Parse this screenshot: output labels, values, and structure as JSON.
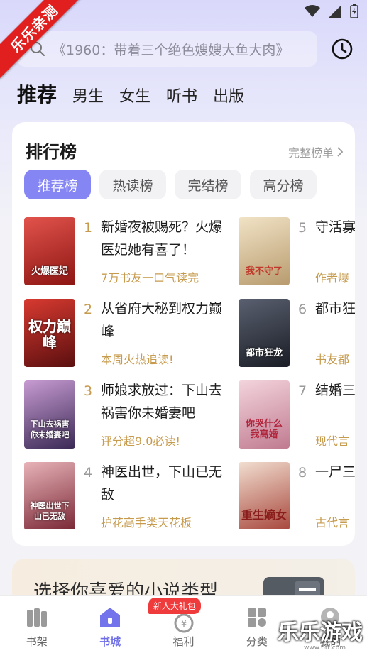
{
  "watermark": {
    "ribbon": "乐乐亲测",
    "site": "乐乐游戏",
    "url": "www.6tt.com"
  },
  "search": {
    "placeholder": "《1960：带着三个绝色嫂嫂大鱼大肉》"
  },
  "top_tabs": [
    {
      "label": "推荐",
      "active": true
    },
    {
      "label": "男生"
    },
    {
      "label": "女生"
    },
    {
      "label": "听书"
    },
    {
      "label": "出版"
    }
  ],
  "ranking": {
    "title": "排行榜",
    "more": "完整榜单",
    "tabs": [
      {
        "label": "推荐榜",
        "active": true
      },
      {
        "label": "热读榜"
      },
      {
        "label": "完结榜"
      },
      {
        "label": "高分榜"
      }
    ],
    "books": [
      {
        "rank": "1",
        "title": "新婚夜被赐死？火爆医妃她有喜了！",
        "tag": "7万书友一口气读完",
        "cover_text": "火爆医妃",
        "cover_color": "#b72420"
      },
      {
        "rank": "2",
        "title": "从省府大秘到权力巅峰",
        "tag": "本周火热追读!",
        "cover_text": "权力巅峰",
        "cover_color": "#8e1a1a"
      },
      {
        "rank": "3",
        "title": "师娘求放过：下山去祸害你未婚妻吧",
        "tag": "评分超9.0必读!",
        "cover_text": "下山去祸害你未婚妻吧",
        "cover_color": "#6b4a8a"
      },
      {
        "rank": "4",
        "title": "神医出世，下山已无敌",
        "tag": "护花高手类天花板",
        "cover_text": "神医出世下山已无敌",
        "cover_color": "#b25a66"
      },
      {
        "rank": "5",
        "title": "守活寡区离婚",
        "tag": "作者爆",
        "cover_text": "我不守了",
        "cover_color": "#cfb68f"
      },
      {
        "rank": "6",
        "title": "都市狂",
        "tag": "书友都",
        "cover_text": "都市狂龙",
        "cover_color": "#2e3440"
      },
      {
        "rank": "7",
        "title": "结婚三我离婚",
        "tag": "现代言",
        "cover_text": "你哭什么我离婚",
        "cover_color": "#d7a7b6"
      },
      {
        "rank": "8",
        "title": "一尸三生嫡女",
        "tag": "古代言",
        "cover_text": "重生嫡女",
        "cover_color": "#a0453a"
      }
    ]
  },
  "genre_promo": {
    "text": "选择你喜爱的小说类型"
  },
  "bottom_nav": [
    {
      "label": "书架",
      "icon": "bookshelf-icon"
    },
    {
      "label": "书城",
      "icon": "bookstore-icon",
      "active": true
    },
    {
      "label": "福利",
      "icon": "welfare-icon",
      "badge": "新人大礼包"
    },
    {
      "label": "分类",
      "icon": "category-icon"
    },
    {
      "label": "我的",
      "icon": "profile-icon"
    }
  ],
  "colors": {
    "accent": "#8585f4",
    "gold": "#c79b4e",
    "active_nav": "#6d6de8"
  }
}
